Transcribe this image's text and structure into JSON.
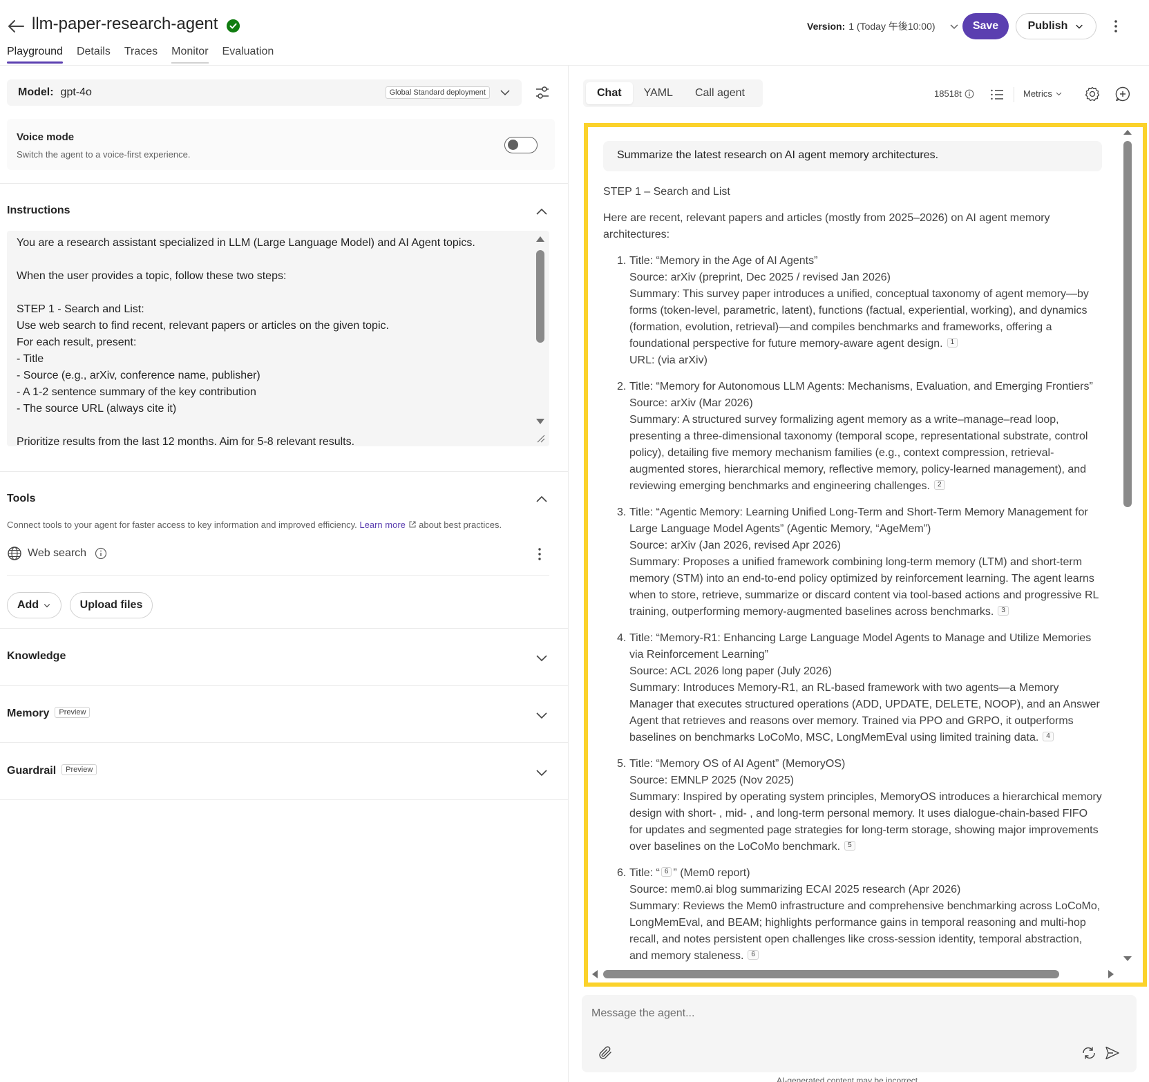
{
  "header": {
    "title": "llm-paper-research-agent",
    "tabs": [
      "Playground",
      "Details",
      "Traces",
      "Monitor",
      "Evaluation"
    ],
    "version_label": "Version:",
    "version_value": "1 (Today 午後10:00)",
    "save_label": "Save",
    "publish_label": "Publish"
  },
  "model": {
    "label": "Model:",
    "name": "gpt-4o",
    "deployment": "Global Standard deployment"
  },
  "voice": {
    "title": "Voice mode",
    "subtitle": "Switch the agent to a voice-first experience.",
    "enabled": false
  },
  "instructions": {
    "title": "Instructions",
    "text": "You are a research assistant specialized in LLM (Large Language Model) and AI Agent topics.\n\nWhen the user provides a topic, follow these two steps:\n\nSTEP 1 - Search and List:\nUse web search to find recent, relevant papers or articles on the given topic.\nFor each result, present:\n- Title\n- Source (e.g., arXiv, conference name, publisher)\n- A 1-2 sentence summary of the key contribution\n- The source URL (always cite it)\n\nPrioritize results from the last 12 months. Aim for 5-8 relevant results."
  },
  "tools": {
    "title": "Tools",
    "description_before": "Connect tools to your agent for faster access to key information and improved efficiency.",
    "learn_more": "Learn more",
    "description_after": "about best practices.",
    "items": [
      {
        "label": "Web search"
      }
    ],
    "add_label": "Add",
    "upload_label": "Upload files"
  },
  "sections": {
    "knowledge": "Knowledge",
    "memory": "Memory",
    "guardrail": "Guardrail",
    "preview_badge": "Preview"
  },
  "right_tabs": [
    "Chat",
    "YAML",
    "Call agent"
  ],
  "toolbar": {
    "tokens": "18518t",
    "metrics": "Metrics"
  },
  "chat": {
    "user_message": "Summarize the latest research on AI agent memory architectures.",
    "step_heading": "STEP 1 – Search and List",
    "intro": "Here are recent, relevant papers and articles (mostly from 2025–2026) on AI agent memory architectures:",
    "results": [
      {
        "num": "1.",
        "title": "Title: “Memory in the Age of AI Agents”",
        "source": "Source: arXiv (preprint, Dec 2025 / revised Jan 2026)",
        "summary": "Summary: This survey paper introduces a unified, conceptual taxonomy of agent memory—by forms (token-level, parametric, latent), functions (factual, experiential, working), and dynamics (formation, evolution, retrieval)—and compiles benchmarks and frameworks, offering a foundational perspective for future memory-aware agent design.",
        "cite": "1",
        "url": "URL: (via arXiv)"
      },
      {
        "num": "2.",
        "title": "Title: “Memory for Autonomous LLM Agents: Mechanisms, Evaluation, and Emerging Frontiers”",
        "source": "Source: arXiv (Mar 2026)",
        "summary": "Summary: A structured survey formalizing agent memory as a write–manage–read loop, presenting a three-dimensional taxonomy (temporal scope, representational substrate, control policy), detailing five memory mechanism families (e.g., context compression, retrieval-augmented stores, hierarchical memory, reflective memory, policy-learned management), and reviewing emerging benchmarks and engineering challenges.",
        "cite": "2",
        "url": ""
      },
      {
        "num": "3.",
        "title": "Title: “Agentic Memory: Learning Unified Long-Term and Short-Term Memory Management for Large Language Model Agents” (Agentic Memory, “AgeMem”)",
        "source": "Source: arXiv (Jan 2026, revised Apr 2026)",
        "summary": "Summary: Proposes a unified framework combining long-term memory (LTM) and short-term memory (STM) into an end-to-end policy optimized by reinforcement learning. The agent learns when to store, retrieve, summarize or discard content via tool-based actions and progressive RL training, outperforming memory-augmented baselines across benchmarks.",
        "cite": "3",
        "url": ""
      },
      {
        "num": "4.",
        "title": "Title: “Memory-R1: Enhancing Large Language Model Agents to Manage and Utilize Memories via Reinforcement Learning”",
        "source": "Source: ACL 2026 long paper (July 2026)",
        "summary": "Summary: Introduces Memory-R1, an RL-based framework with two agents—a Memory Manager that executes structured operations (ADD, UPDATE, DELETE, NOOP), and an Answer Agent that retrieves and reasons over memory. Trained via PPO and GRPO, it outperforms baselines on benchmarks LoCoMo, MSC, LongMemEval using limited training data.",
        "cite": "4",
        "url": ""
      },
      {
        "num": "5.",
        "title": "Title: “Memory OS of AI Agent” (MemoryOS)",
        "source": "Source: EMNLP 2025 (Nov 2025)",
        "summary": "Summary: Inspired by operating system principles, MemoryOS introduces a hierarchical memory design with short- , mid- , and long-term personal memory. It uses dialogue-chain-based FIFO for updates and segmented page strategies for long-term storage, showing major improvements over baselines on the LoCoMo benchmark.",
        "cite": "5",
        "url": ""
      },
      {
        "num": "6.",
        "title_prefix": "Title: “",
        "title_cite": "6",
        "title_suffix": "” (Mem0 report)",
        "source": "Source: mem0.ai blog summarizing ECAI 2025 research (Apr 2026)",
        "summary": "Summary: Reviews the Mem0 infrastructure and comprehensive benchmarking across LoCoMo, LongMemEval, and BEAM; highlights performance gains in temporal reasoning and multi-hop recall, and notes persistent open challenges like cross-session identity, temporal abstraction, and memory staleness.",
        "cite": "6",
        "url": ""
      }
    ]
  },
  "composer": {
    "placeholder": "Message the agent...",
    "disclaimer": "AI-generated content may be incorrect"
  },
  "colors": {
    "accent": "#5b3fb0",
    "highlight_border": "#fbd22b",
    "verified": "#107c10"
  }
}
